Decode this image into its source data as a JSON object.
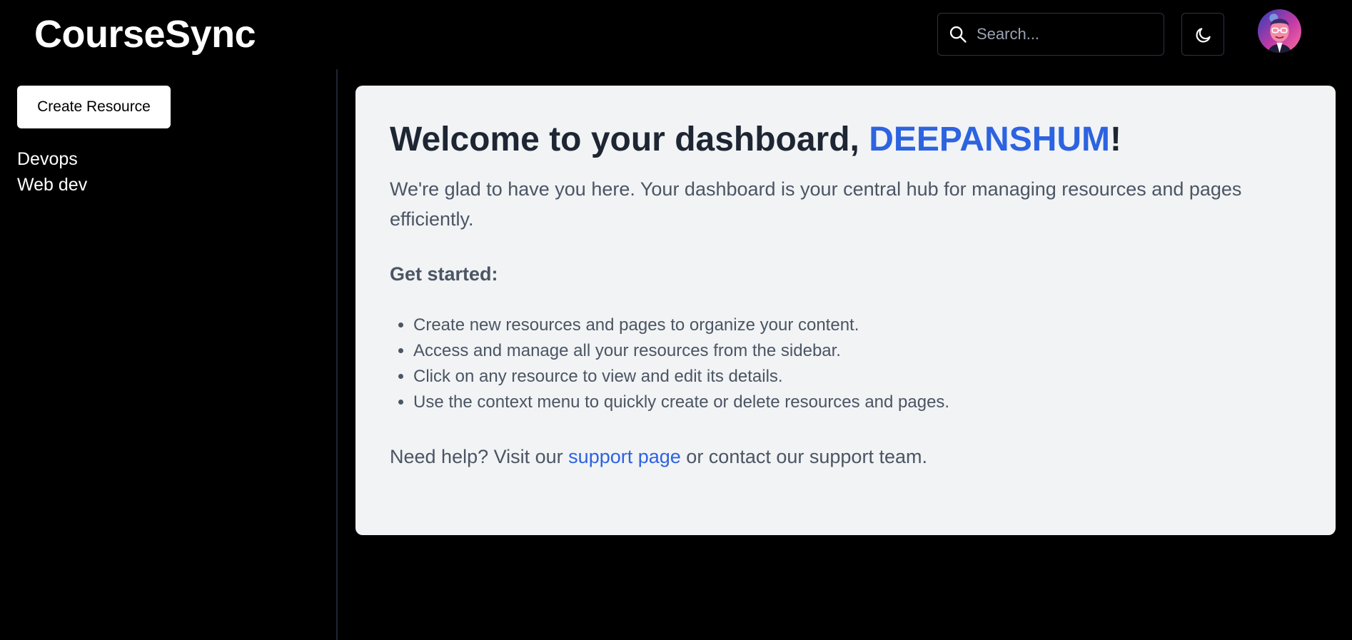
{
  "app": {
    "brand": "CourseSync"
  },
  "header": {
    "search_placeholder": "Search...",
    "search_value": ""
  },
  "sidebar": {
    "create_label": "Create Resource",
    "resources": [
      "Devops",
      "Web dev"
    ]
  },
  "dashboard": {
    "title_prefix": "Welcome to your dashboard, ",
    "user_name": "DEEPANSHUM",
    "title_suffix": "!",
    "intro": "We're glad to have you here. Your dashboard is your central hub for managing resources and pages efficiently.",
    "get_started_label": "Get started:",
    "steps": [
      "Create new resources and pages to organize your content.",
      "Access and manage all your resources from the sidebar.",
      "Click on any resource to view and edit its details.",
      "Use the context menu to quickly create or delete resources and pages."
    ],
    "help_prefix": "Need help? Visit our ",
    "help_link": "support page",
    "help_suffix": " or contact our support team."
  },
  "colors": {
    "background": "#000000",
    "card": "#f1f3f5",
    "accent": "#2d63e0",
    "heading": "#1e2633",
    "body_text": "#4b5563"
  },
  "icons": {
    "search": "search-icon",
    "theme": "moon-icon",
    "avatar": "avatar"
  }
}
